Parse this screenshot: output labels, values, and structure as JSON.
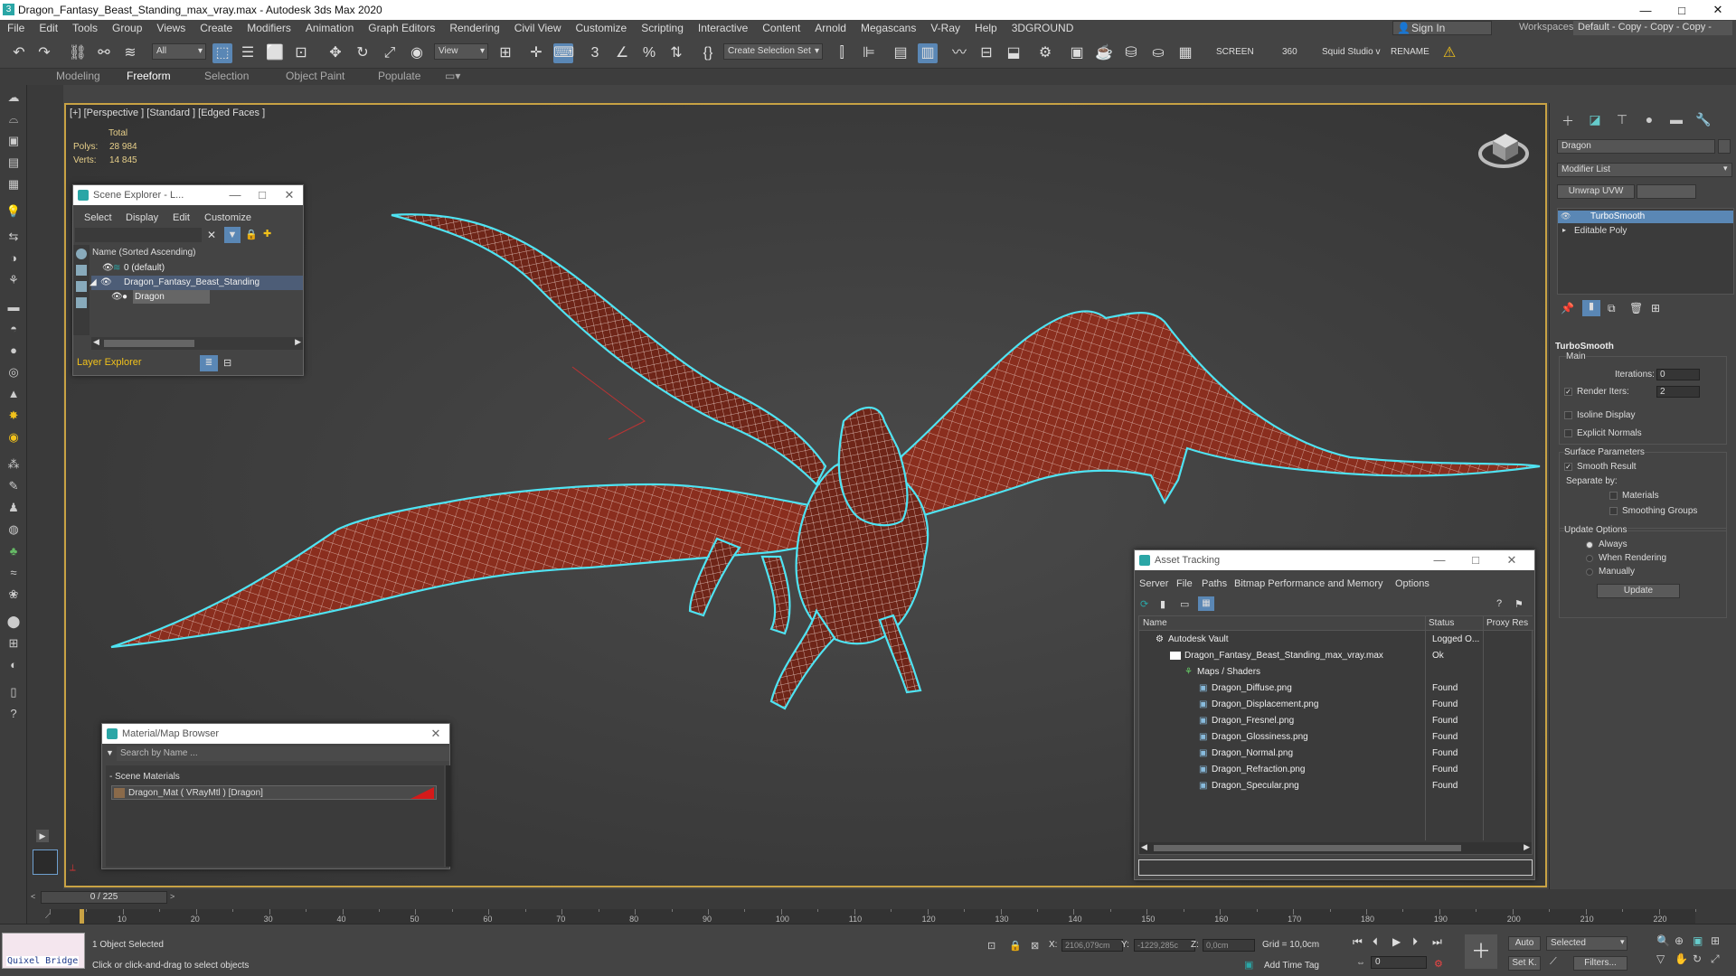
{
  "window": {
    "title": "Dragon_Fantasy_Beast_Standing_max_vray.max - Autodesk 3ds Max 2020",
    "min": "—",
    "max": "□",
    "close": "✕"
  },
  "menu": [
    "File",
    "Edit",
    "Tools",
    "Group",
    "Views",
    "Create",
    "Modifiers",
    "Animation",
    "Graph Editors",
    "Rendering",
    "Civil View",
    "Customize",
    "Scripting",
    "Interactive",
    "Content",
    "Arnold",
    "Megascans",
    "V-Ray",
    "Help",
    "3DGROUND"
  ],
  "signin": "Sign In",
  "workspaces_label": "Workspaces:",
  "workspace_value": "Default - Copy - Copy - Copy - Copy",
  "toolbar": {
    "filter": "All",
    "view": "View",
    "selection_set": "Create Selection Set",
    "screen": "SCREEN",
    "n360": "360",
    "squid": "Squid Studio v",
    "rename": "RENAME"
  },
  "ribbon": [
    "Modeling",
    "Freeform",
    "Selection",
    "Object Paint",
    "Populate"
  ],
  "viewport": {
    "label": "[+] [Perspective ] [Standard ] [Edged Faces ]",
    "total": "Total",
    "polys_label": "Polys:",
    "polys": "28 984",
    "verts_label": "Verts:",
    "verts": "14 845"
  },
  "scene_explorer": {
    "title": "Scene Explorer - L...",
    "menu": [
      "Select",
      "Display",
      "Edit",
      "Customize"
    ],
    "header": "Name (Sorted Ascending)",
    "items": [
      "0 (default)",
      "Dragon_Fantasy_Beast_Standing",
      "Dragon"
    ],
    "footer": "Layer Explorer"
  },
  "asset_tracking": {
    "title": "Asset Tracking",
    "menu": [
      "Server",
      "File",
      "Paths",
      "Bitmap Performance and Memory",
      "Options"
    ],
    "cols": [
      "Name",
      "Status",
      "Proxy Res"
    ],
    "rows": [
      [
        "Autodesk Vault",
        "Logged O..."
      ],
      [
        "Dragon_Fantasy_Beast_Standing_max_vray.max",
        "Ok"
      ],
      [
        "Maps / Shaders",
        ""
      ],
      [
        "Dragon_Diffuse.png",
        "Found"
      ],
      [
        "Dragon_Displacement.png",
        "Found"
      ],
      [
        "Dragon_Fresnel.png",
        "Found"
      ],
      [
        "Dragon_Glossiness.png",
        "Found"
      ],
      [
        "Dragon_Normal.png",
        "Found"
      ],
      [
        "Dragon_Refraction.png",
        "Found"
      ],
      [
        "Dragon_Specular.png",
        "Found"
      ]
    ]
  },
  "material_browser": {
    "title": "Material/Map Browser",
    "search": "Search by Name ...",
    "section": "- Scene Materials",
    "item": "Dragon_Mat  ( VRayMtl )  [Dragon]"
  },
  "command_panel": {
    "object_name": "Dragon",
    "modifier_list": "Modifier List",
    "unwrap": "Unwrap UVW",
    "stack": [
      "TurboSmooth",
      "Editable Poly"
    ],
    "rollout": "TurboSmooth",
    "main": "Main",
    "iterations_label": "Iterations:",
    "iterations": "0",
    "render_iters_label": "Render Iters:",
    "render_iters": "2",
    "isoline": "Isoline Display",
    "explicit": "Explicit Normals",
    "surface": "Surface Parameters",
    "smooth": "Smooth Result",
    "separate": "Separate by:",
    "materials": "Materials",
    "smoothing": "Smoothing Groups",
    "update_opts": "Update Options",
    "always": "Always",
    "when_render": "When Rendering",
    "manually": "Manually",
    "update_btn": "Update"
  },
  "timeline": {
    "frame": "0 / 225",
    "ticks": [
      "10",
      "20",
      "30",
      "40",
      "50",
      "60",
      "70",
      "80",
      "90",
      "100",
      "110",
      "120",
      "130",
      "140",
      "150",
      "160",
      "170",
      "180",
      "190",
      "200",
      "210",
      "220"
    ]
  },
  "status": {
    "quixel": "Quixel Bridge",
    "selected": "1 Object Selected",
    "hint": "Click or click-and-drag to select objects",
    "x_label": "X:",
    "x": "2106,079cm",
    "y_label": "Y:",
    "y": "-1229,285c",
    "z_label": "Z:",
    "z": "0,0cm",
    "grid": "Grid = 10,0cm",
    "add_time_tag": "Add Time Tag",
    "auto": "Auto",
    "set_key": "Set K.",
    "selected_drop": "Selected",
    "filters": "Filters...",
    "frame_field": "0"
  }
}
